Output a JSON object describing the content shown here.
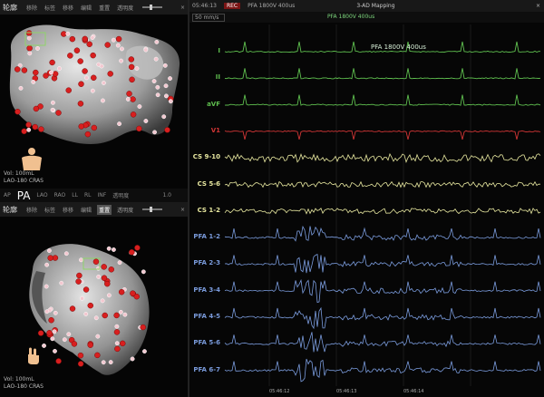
{
  "map_top": {
    "title": "轮廓",
    "toolbar_items": [
      "移除",
      "标签",
      "移移",
      "编辑",
      "重置",
      "透明度"
    ],
    "info": [
      "Vol: 100mL",
      "LAO-180 CRAS"
    ]
  },
  "view_bar": {
    "items": [
      "AP",
      "PA",
      "LAO",
      "RAO",
      "LL",
      "RL",
      "INF"
    ],
    "opacity_label": "透明度",
    "opacity_value": "1.0"
  },
  "map_bottom": {
    "title": "轮廓",
    "toolbar_items": [
      "移除",
      "标签",
      "移移",
      "编辑",
      "重置",
      "透明度"
    ],
    "info": [
      "Vol: 100mL",
      "LAO-180 CRAS"
    ]
  },
  "ep_window": {
    "timestamp": "05:46:13",
    "rec": "REC",
    "stim_title": "PFA 1800V 400us",
    "window_title": "3-AD Mapping",
    "speed": "50 mm/s",
    "marker": "PFA 1800V 400us",
    "stim_label": "PFA 1800V 400us",
    "channels": [
      {
        "name": "I",
        "color": "#5fbf4f"
      },
      {
        "name": "II",
        "color": "#5fbf4f"
      },
      {
        "name": "aVF",
        "color": "#5fbf4f"
      },
      {
        "name": "V1",
        "color": "#d03535"
      },
      {
        "name": "CS 9-10",
        "color": "#e8e8a0"
      },
      {
        "name": "CS 5-6",
        "color": "#e8e8a0"
      },
      {
        "name": "CS 1-2",
        "color": "#e8e8a0"
      },
      {
        "name": "PFA 1-2",
        "color": "#7a9bdc"
      },
      {
        "name": "PFA 2-3",
        "color": "#7a9bdc"
      },
      {
        "name": "PFA 3-4",
        "color": "#7a9bdc"
      },
      {
        "name": "PFA 4-5",
        "color": "#7a9bdc"
      },
      {
        "name": "PFA 5-6",
        "color": "#7a9bdc"
      },
      {
        "name": "PFA 6-7",
        "color": "#7a9bdc"
      }
    ],
    "time_labels": [
      "05:46:12",
      "05:46:13",
      "05:46:14"
    ]
  },
  "colors": {
    "ecg": "#5fbf4f",
    "v1": "#d03535",
    "cs": "#e8e8a0",
    "pfa": "#7a9bdc",
    "ablation_point": "#d81f1f"
  }
}
